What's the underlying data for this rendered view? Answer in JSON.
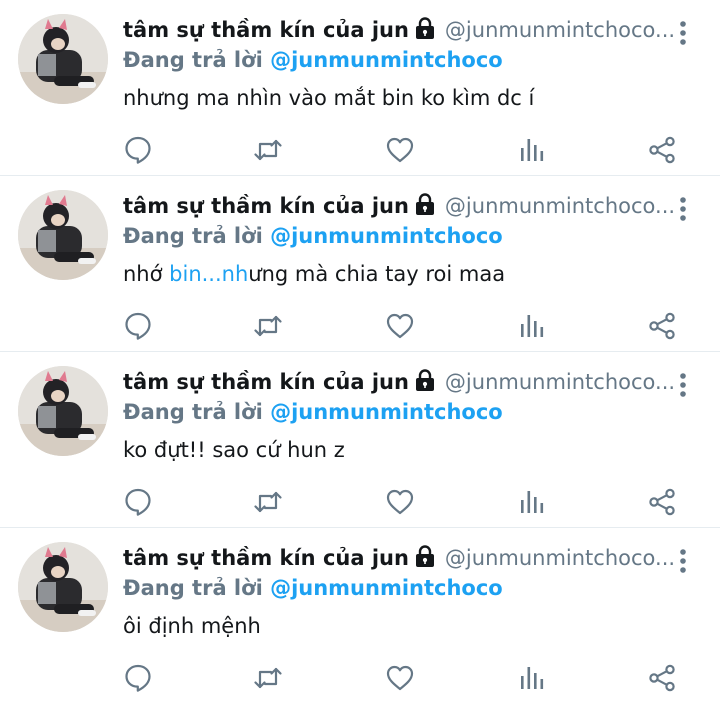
{
  "colors": {
    "accent": "#1da1f2",
    "muted": "#657786",
    "text": "#14171a",
    "divider": "#e6ecf0"
  },
  "icons": {
    "more": "more-vertical-icon",
    "reply": "comment-icon",
    "retweet": "retweet-icon",
    "like": "heart-icon",
    "analytics": "analytics-icon",
    "share": "share-icon",
    "protected": "lock-icon"
  },
  "tweets": [
    {
      "name": "tâm sự thầm kín của jun",
      "handle": "@junmunmintchoco...",
      "reply_prefix": "Đang trả lời",
      "reply_to": "@junmunmintchoco",
      "text_before": "nhưng ma nhìn vào mắt bin ko kìm dc í",
      "text_link": "",
      "text_after": ""
    },
    {
      "name": "tâm sự thầm kín của jun",
      "handle": "@junmunmintchoco...",
      "reply_prefix": "Đang trả lời",
      "reply_to": "@junmunmintchoco",
      "text_before": "nhớ ",
      "text_link": "bin...nh",
      "text_after": "ưng mà chia tay roi maa"
    },
    {
      "name": "tâm sự thầm kín của jun",
      "handle": "@junmunmintchoco...",
      "reply_prefix": "Đang trả lời",
      "reply_to": "@junmunmintchoco",
      "text_before": "ko đựt!! sao cứ hun z",
      "text_link": "",
      "text_after": ""
    },
    {
      "name": "tâm sự thầm kín của jun",
      "handle": "@junmunmintchoco...",
      "reply_prefix": "Đang trả lời",
      "reply_to": "@junmunmintchoco",
      "text_before": "ôi định mệnh",
      "text_link": "",
      "text_after": ""
    }
  ]
}
